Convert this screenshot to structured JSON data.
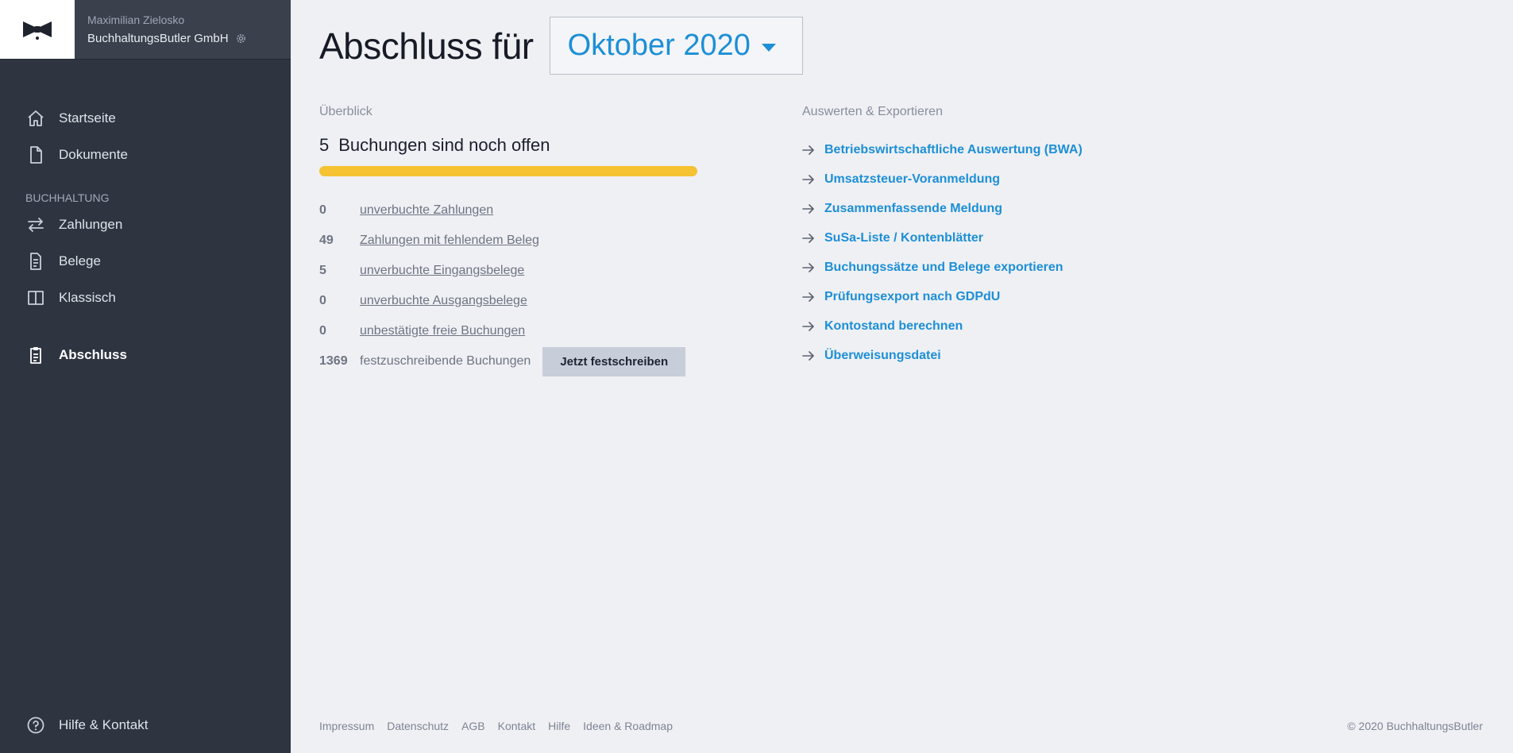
{
  "account": {
    "user": "Maximilian Zielosko",
    "company": "BuchhaltungsButler GmbH",
    "settings_icon": "gear-icon"
  },
  "nav": {
    "startseite": "Startseite",
    "dokumente": "Dokumente",
    "section_buchhaltung": "BUCHHALTUNG",
    "zahlungen": "Zahlungen",
    "belege": "Belege",
    "klassisch": "Klassisch",
    "abschluss": "Abschluss",
    "hilfe": "Hilfe & Kontakt"
  },
  "header": {
    "title": "Abschluss für",
    "period": "Oktober 2020"
  },
  "overview": {
    "label": "Überblick",
    "open_count": "5",
    "open_text": "Buchungen sind noch offen",
    "progress_fraction": 1.0,
    "stats": [
      {
        "count": "0",
        "label": "unverbuchte Zahlungen"
      },
      {
        "count": "49",
        "label": "Zahlungen mit fehlendem Beleg"
      },
      {
        "count": "5",
        "label": "unverbuchte Eingangsbelege"
      },
      {
        "count": "0",
        "label": "unverbuchte Ausgangsbelege"
      },
      {
        "count": "0",
        "label": "unbestätigte freie Buchungen"
      }
    ],
    "commit": {
      "count": "1369",
      "label": "festzuschreibende Buchungen",
      "button": "Jetzt festschreiben"
    }
  },
  "exports": {
    "label": "Auswerten & Exportieren",
    "items": [
      "Betriebswirtschaftliche Auswertung (BWA)",
      "Umsatzsteuer-Voranmeldung",
      "Zusammenfassende Meldung",
      "SuSa-Liste / Kontenblätter",
      "Buchungssätze und Belege exportieren",
      "Prüfungsexport nach GDPdU",
      "Kontostand berechnen",
      "Überweisungsdatei"
    ]
  },
  "footer": {
    "links": [
      "Impressum",
      "Datenschutz",
      "AGB",
      "Kontakt",
      "Hilfe",
      "Ideen & Roadmap"
    ],
    "copyright": "© 2020 BuchhaltungsButler"
  },
  "colors": {
    "sidebar_bg": "#2e3440",
    "main_bg": "#eff0f4",
    "accent": "#1d8fd6",
    "progress": "#f5c232"
  }
}
